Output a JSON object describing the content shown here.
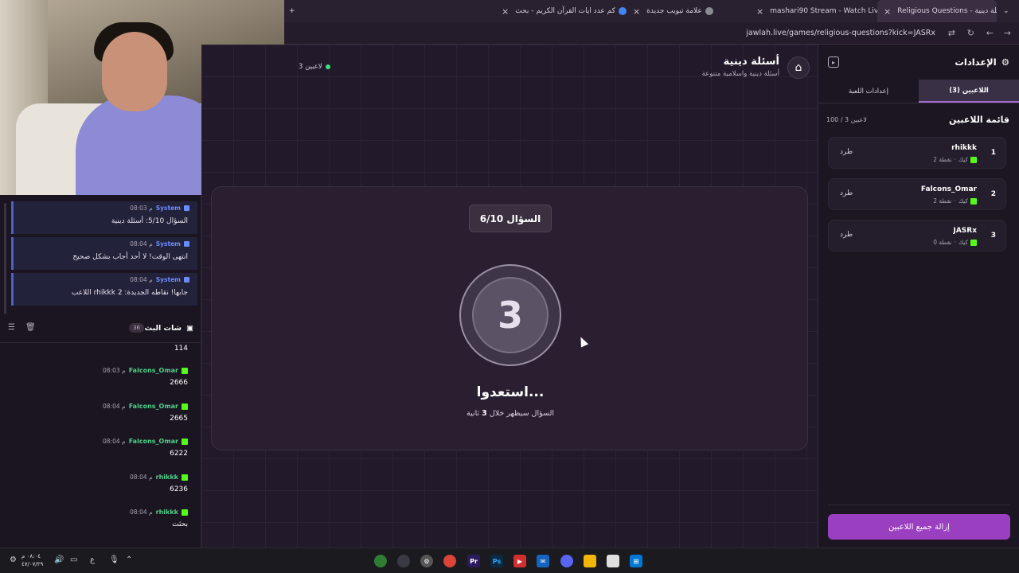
{
  "browser": {
    "tabs": [
      {
        "title": "كم عدد ايات القرآن الكريم - بحث",
        "color": "#4285f4"
      },
      {
        "title": "علامة تبويب جديدة",
        "color": "#5f6368"
      },
      {
        "title": "mashari90 Stream - Watch Live",
        "color": "#53fc18"
      },
      {
        "title": "Religious Questions - أسئلة دينية",
        "color": "#6a4fa0"
      }
    ],
    "url": "jawlah.live/games/religious-questions?kick=JASRx"
  },
  "left_panel": {
    "system_messages": [
      {
        "author": "System",
        "time": "08:03 م",
        "text": "السؤال 5/10: أسئلة دينية"
      },
      {
        "author": "System",
        "time": "08:04 م",
        "text": "انتهى الوقت! لا أحد أجاب بشكل صحيح"
      },
      {
        "author": "System",
        "time": "08:04 م",
        "text": "اللاعب rhikkk جابها! نقاطه الجديدة: 2"
      }
    ],
    "chat_title": "شات البث",
    "chat_count": "36",
    "first_body": "114",
    "messages": [
      {
        "user": "Falcons_Omar",
        "time": "08:03 م",
        "body": "2666"
      },
      {
        "user": "Falcons_Omar",
        "time": "08:04 م",
        "body": "2665"
      },
      {
        "user": "Falcons_Omar",
        "time": "08:04 م",
        "body": "6222"
      },
      {
        "user": "rhikkk",
        "time": "08:04 م",
        "body": "6236"
      },
      {
        "user": "rhikkk",
        "time": "08:04 م",
        "body": "بحثت"
      }
    ]
  },
  "game": {
    "title": "أسئلة دينية",
    "subtitle": "أسئلة دينية واسلامية متنوعة",
    "players_online": "3 لاعبين",
    "question_badge": "السؤال 6/10",
    "countdown": "3",
    "get_ready": "استعدوا...",
    "appearing_prefix": "السؤال سيظهر خلال",
    "appearing_seconds": "3",
    "appearing_suffix": "ثانية"
  },
  "settings": {
    "title": "الإعدادات",
    "tab_players": "اللاعبين (3)",
    "tab_game": "إعدادات اللعبة",
    "players_heading": "قائمة اللاعبين",
    "players_count": "100 / 3 لاعبين",
    "players": [
      {
        "rank": "1",
        "name": "rhikkk",
        "points": "2 نقطة",
        "platform": "كيك",
        "kick_label": "طرد"
      },
      {
        "rank": "2",
        "name": "Falcons_Omar",
        "points": "2 نقطة",
        "platform": "كيك",
        "kick_label": "طرد"
      },
      {
        "rank": "3",
        "name": "JASRx",
        "points": "0 نقطة",
        "platform": "كيك",
        "kick_label": "طرد"
      }
    ],
    "remove_all": "إزالة جميع اللاعبين"
  },
  "taskbar": {
    "time": "٠٨:٠٤ م",
    "date": "٤٧/٠٧/٢٩",
    "lang": "ع"
  },
  "colors": {
    "accent_purple": "#9a3fc0",
    "kick_green": "#53fc18",
    "system_blue": "#6b8cff",
    "username_green": "#4fd08a"
  }
}
